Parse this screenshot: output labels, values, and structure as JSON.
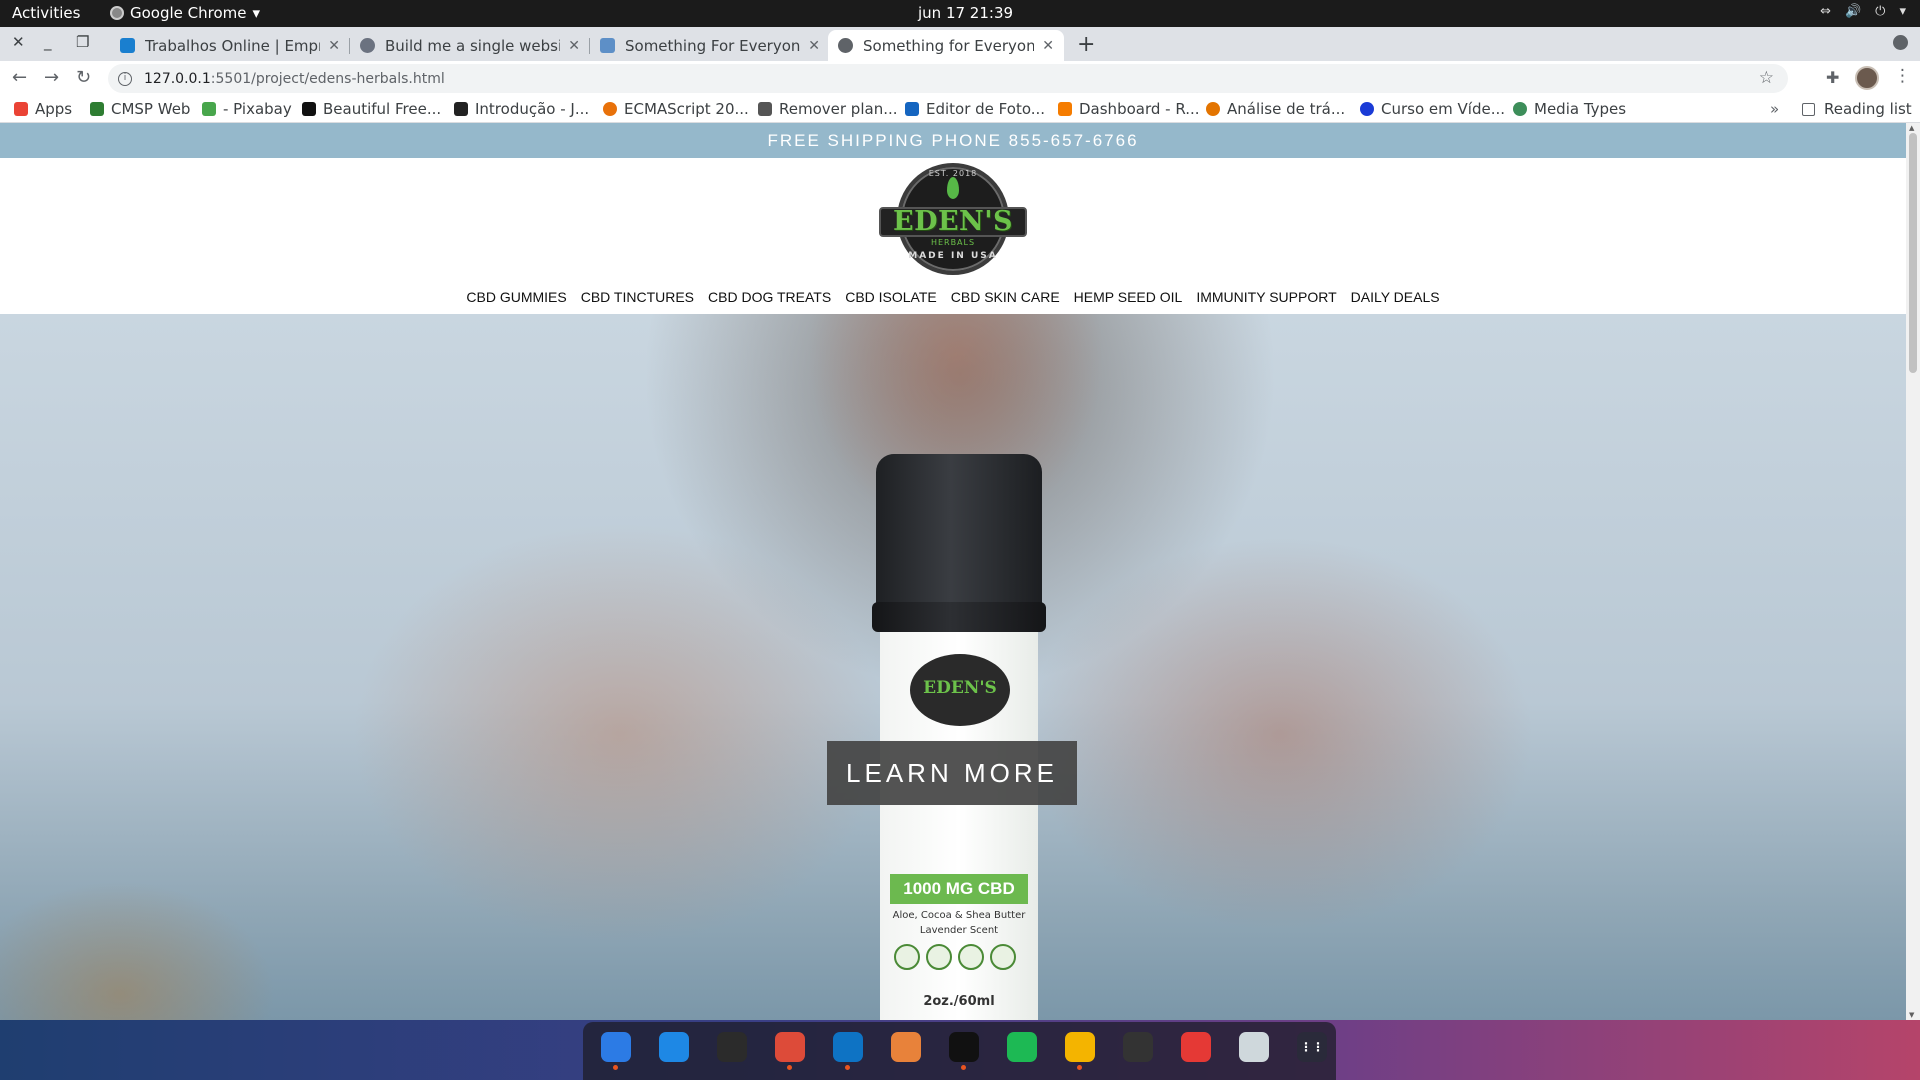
{
  "system": {
    "activities": "Activities",
    "app_menu": "Google Chrome",
    "clock": "jun 17  21:39"
  },
  "browser": {
    "tabs": [
      {
        "label": "Trabalhos Online | Empre",
        "favicon_color": "#1a7fcf",
        "active": false
      },
      {
        "label": "Build me a single website",
        "favicon_color": "#6b7280",
        "active": false
      },
      {
        "label": "Something For Everyone",
        "favicon_color": "#5d8fc7",
        "active": false
      },
      {
        "label": "Something for Everyone",
        "favicon_color": "#5f6368",
        "active": true
      }
    ],
    "url_host": "127.0.0.1",
    "url_rest": ":5501/project/edens-herbals.html",
    "bookmarks": [
      {
        "label": "Apps",
        "icon": "apps-grid-icon",
        "color": "#ea4335"
      },
      {
        "label": "CMSP Web",
        "icon": "cmsp-icon",
        "color": "#2e7d32"
      },
      {
        "label": "- Pixabay",
        "icon": "pixabay-icon",
        "color": "#48a64c"
      },
      {
        "label": "Beautiful Free...",
        "icon": "unsplash-icon",
        "color": "#111111"
      },
      {
        "label": "Introdução - J...",
        "icon": "doc-icon",
        "color": "#222222"
      },
      {
        "label": "ECMAScript 20...",
        "icon": "ecma-icon",
        "color": "#e8710a"
      },
      {
        "label": "Remover plan...",
        "icon": "remove-bg-icon",
        "color": "#555555"
      },
      {
        "label": "Editor de Foto...",
        "icon": "photo-editor-icon",
        "color": "#1565c0"
      },
      {
        "label": "Dashboard - R...",
        "icon": "dashboard-icon",
        "color": "#f57c00"
      },
      {
        "label": "Análise de trá...",
        "icon": "analytics-icon",
        "color": "#e37400"
      },
      {
        "label": "Curso em Víde...",
        "icon": "video-course-icon",
        "color": "#1a3bd6"
      },
      {
        "label": "Media Types",
        "icon": "globe-icon",
        "color": "#3d8e5a"
      }
    ],
    "reading_list": "Reading list"
  },
  "page": {
    "promo": "FREE SHIPPING PHONE 855-657-6766",
    "logo": {
      "est": "EST. 2018",
      "brand": "EDEN'S",
      "sub": "HERBALS",
      "made": "MADE IN USA"
    },
    "nav": [
      "CBD GUMMIES",
      "CBD TINCTURES",
      "CBD DOG TREATS",
      "CBD ISOLATE",
      "CBD SKIN CARE",
      "HEMP SEED OIL",
      "IMMUNITY SUPPORT",
      "DAILY DEALS"
    ],
    "hero": {
      "bottle_brand": "EDEN'S",
      "dose": "1000 MG CBD",
      "desc_1": "Aloe, Cocoa & Shea Butter",
      "desc_2": "Lavender Scent",
      "size": "2oz./60ml",
      "cta": "LEARN MORE"
    }
  },
  "dock": [
    {
      "name": "finder-icon",
      "color": "#2c7be5",
      "running": true
    },
    {
      "name": "app-store-icon",
      "color": "#1e88e5",
      "running": false
    },
    {
      "name": "terminal-icon",
      "color": "#2b2b2b",
      "running": false
    },
    {
      "name": "chrome-icon",
      "color": "#dd4b39",
      "running": true
    },
    {
      "name": "vscode-icon",
      "color": "#0e73c4",
      "running": true
    },
    {
      "name": "sublime-icon",
      "color": "#e8823a",
      "running": false
    },
    {
      "name": "github-icon",
      "color": "#111111",
      "running": true
    },
    {
      "name": "spotify-icon",
      "color": "#1db954",
      "running": false
    },
    {
      "name": "photos-icon",
      "color": "#f4b400",
      "running": true
    },
    {
      "name": "phone-icon",
      "color": "#333333",
      "running": false
    },
    {
      "name": "mail-icon",
      "color": "#e53935",
      "running": false
    },
    {
      "name": "trash-icon",
      "color": "#cfd8dc",
      "running": false
    },
    {
      "name": "app-grid-icon",
      "color": "#2a2a3a",
      "running": false
    }
  ]
}
